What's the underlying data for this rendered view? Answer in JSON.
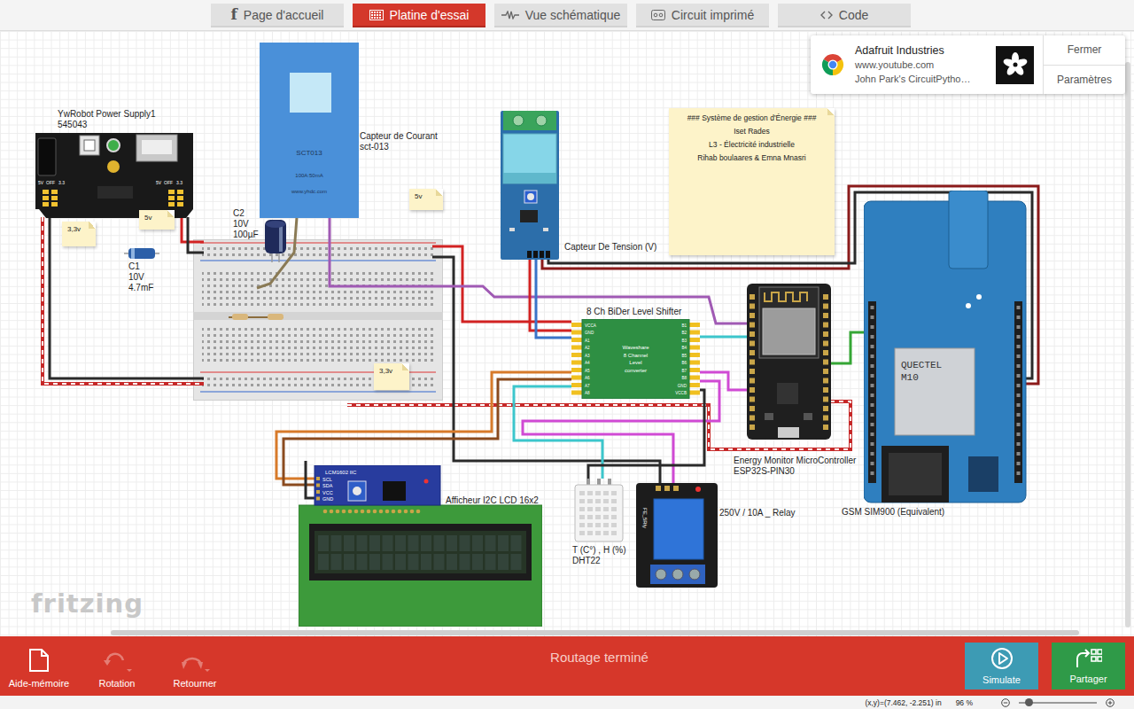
{
  "tabs": [
    {
      "label": "Page d'accueil",
      "kind": "home",
      "icon": "f",
      "selected": false
    },
    {
      "label": "Platine d'essai",
      "kind": "breadboard",
      "selected": true
    },
    {
      "label": "Vue schématique",
      "kind": "schematic",
      "selected": false
    },
    {
      "label": "Circuit imprimé",
      "kind": "pcb",
      "selected": false
    },
    {
      "label": "Code",
      "kind": "code",
      "selected": false
    }
  ],
  "notification": {
    "title": "Adafruit Industries",
    "url": "www.youtube.com",
    "text": "John Park's CircuitPytho…",
    "buttons": [
      "Fermer",
      "Paramètres"
    ]
  },
  "canvas": {
    "watermark": "fritzing",
    "notes": [
      {
        "kind": "sticky",
        "lines": [
          "### Système de gestion d'Énergie ###",
          "Iset Rades",
          "L3 - Électricité industrielle",
          "Rihab boulaares & Emna Mnasri"
        ]
      },
      {
        "kind": "tag",
        "lines": [
          "3,3v"
        ]
      },
      {
        "kind": "tag",
        "lines": [
          "5v"
        ]
      },
      {
        "kind": "tag",
        "lines": [
          "5v"
        ]
      },
      {
        "kind": "tag",
        "lines": [
          "3,3v"
        ]
      }
    ],
    "parts": [
      {
        "kind": "power-supply",
        "label": [
          "YwRobot Power Supply1",
          "545043"
        ],
        "texts": [
          "5V",
          "OFF",
          "3.3"
        ]
      },
      {
        "kind": "breadboard",
        "label": []
      },
      {
        "kind": "capacitor-axial",
        "label": [
          "C1",
          "10V",
          "4.7mF"
        ]
      },
      {
        "kind": "capacitor-radial",
        "label": [
          "C2",
          "10V",
          "100µF"
        ]
      },
      {
        "kind": "current-sensor",
        "label": [
          "Capteur de Courant",
          "sct-013"
        ],
        "texts": [
          "SCT013",
          "100A:50mA",
          "www.yhdc.com"
        ]
      },
      {
        "kind": "voltage-sensor",
        "label": [
          "Capteur De Tension (V)"
        ]
      },
      {
        "kind": "level-shifter",
        "label": [
          "8 Ch BiDer Level Shifter"
        ],
        "texts": [
          "Waveshare",
          "8 Channel",
          "Level",
          "converter"
        ],
        "pins_left": [
          "VCCA",
          "GND",
          "A1",
          "A2",
          "A3",
          "A4",
          "A5",
          "A6",
          "A7",
          "A8"
        ],
        "pins_right": [
          "B1",
          "B2",
          "B3",
          "B4",
          "B5",
          "B6",
          "B7",
          "B8",
          "GND",
          "VCCB"
        ]
      },
      {
        "kind": "microcontroller",
        "label": [
          "Energy Monitor MicroController",
          "ESP32S-PIN30"
        ]
      },
      {
        "kind": "gsm",
        "label": [
          "GSM SIM900 (Equivalent)"
        ],
        "texts": [
          "QUECTEL",
          "M10"
        ]
      },
      {
        "kind": "lcd",
        "label": [
          "Afficheur I2C LCD 16x2"
        ],
        "texts": [
          "LCM1602 IIC"
        ],
        "pins": [
          "SCL",
          "SDA",
          "VCC",
          "GND"
        ]
      },
      {
        "kind": "dht",
        "label": [
          "T (C°) , H (%)",
          "DHT22"
        ]
      },
      {
        "kind": "relay",
        "label": [
          "250V / 10A _ Relay"
        ],
        "texts": [
          "FE_5Rly"
        ]
      }
    ]
  },
  "toolbar": {
    "tools": [
      {
        "label": "Aide-mémoire",
        "kind": "document",
        "disabled": false
      },
      {
        "label": "Rotation",
        "kind": "rotate",
        "disabled": true
      },
      {
        "label": "Retourner",
        "kind": "flip",
        "disabled": true
      }
    ],
    "status": "Routage terminé",
    "actions": [
      {
        "label": "Simulate",
        "kind": "simulate"
      },
      {
        "label": "Partager",
        "kind": "share"
      }
    ]
  },
  "status_bar": {
    "coords": "(x,y)=(7.462, -2.251) in",
    "zoom": "96 %",
    "zoom_level": 0.12
  }
}
